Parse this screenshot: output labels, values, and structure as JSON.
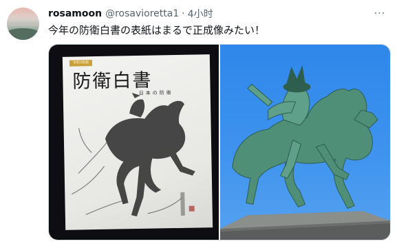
{
  "tweet": {
    "display_name": "rosamoon",
    "handle": "@rosavioretta1",
    "separator": "·",
    "time": "4小时",
    "more_label": "···",
    "text": "今年の防衛白書の表紙はまるで正成像みたい！"
  },
  "media": {
    "cover_badge": "令和3年版",
    "cover_title": "防衛白書",
    "cover_subtitle": "日本の防衛"
  },
  "icons": {
    "more": "more-icon"
  },
  "colors": {
    "name": "#0f1419",
    "secondary": "#536471",
    "border": "#cfd9de",
    "sky": "#3e93ee",
    "bronze": "#5e9e86"
  }
}
